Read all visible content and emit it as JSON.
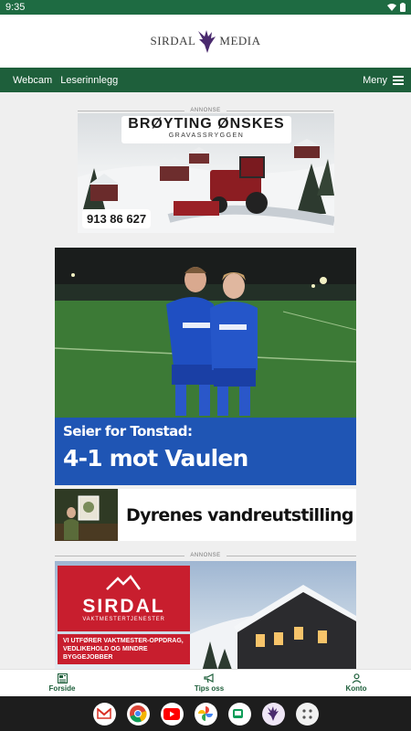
{
  "status": {
    "time": "9:35"
  },
  "brand": {
    "left": "SIRDAL",
    "right": "MEDIA"
  },
  "nav": {
    "links": [
      "Webcam",
      "Leserinnlegg"
    ],
    "menu_label": "Meny"
  },
  "ad1": {
    "label": "ANNONSE",
    "title": "BRØYTING ØNSKES",
    "subtitle": "GRAVASSRYGGEN",
    "phone": "913 86 627"
  },
  "hero": {
    "kicker": "Seier for Tonstad:",
    "title": "4-1 mot Vaulen",
    "shirt_text": "BANKEN"
  },
  "story2": {
    "title": "Dyrenes vandreutstilling"
  },
  "ad2": {
    "label": "ANNONSE",
    "brand": "SIRDAL",
    "tagline": "VAKTMESTERTJENESTER",
    "text": "VI UTFØRER VAKTMESTER-OPPDRAG, VEDLIKEHOLD OG MINDRE BYGGEJOBBER"
  },
  "bottom_nav": [
    {
      "label": "Forside",
      "icon": "newspaper-icon"
    },
    {
      "label": "Tips oss",
      "icon": "megaphone-icon"
    },
    {
      "label": "Konto",
      "icon": "person-icon"
    }
  ],
  "dock_apps": [
    "gmail-icon",
    "chrome-icon",
    "youtube-icon",
    "photos-icon",
    "meet-icon",
    "sirdal-media-app-icon",
    "app-drawer-icon"
  ],
  "colors": {
    "brand_green": "#1e5f3b",
    "hero_blue": "#1f55b4",
    "ad_red": "#c81e2e"
  }
}
